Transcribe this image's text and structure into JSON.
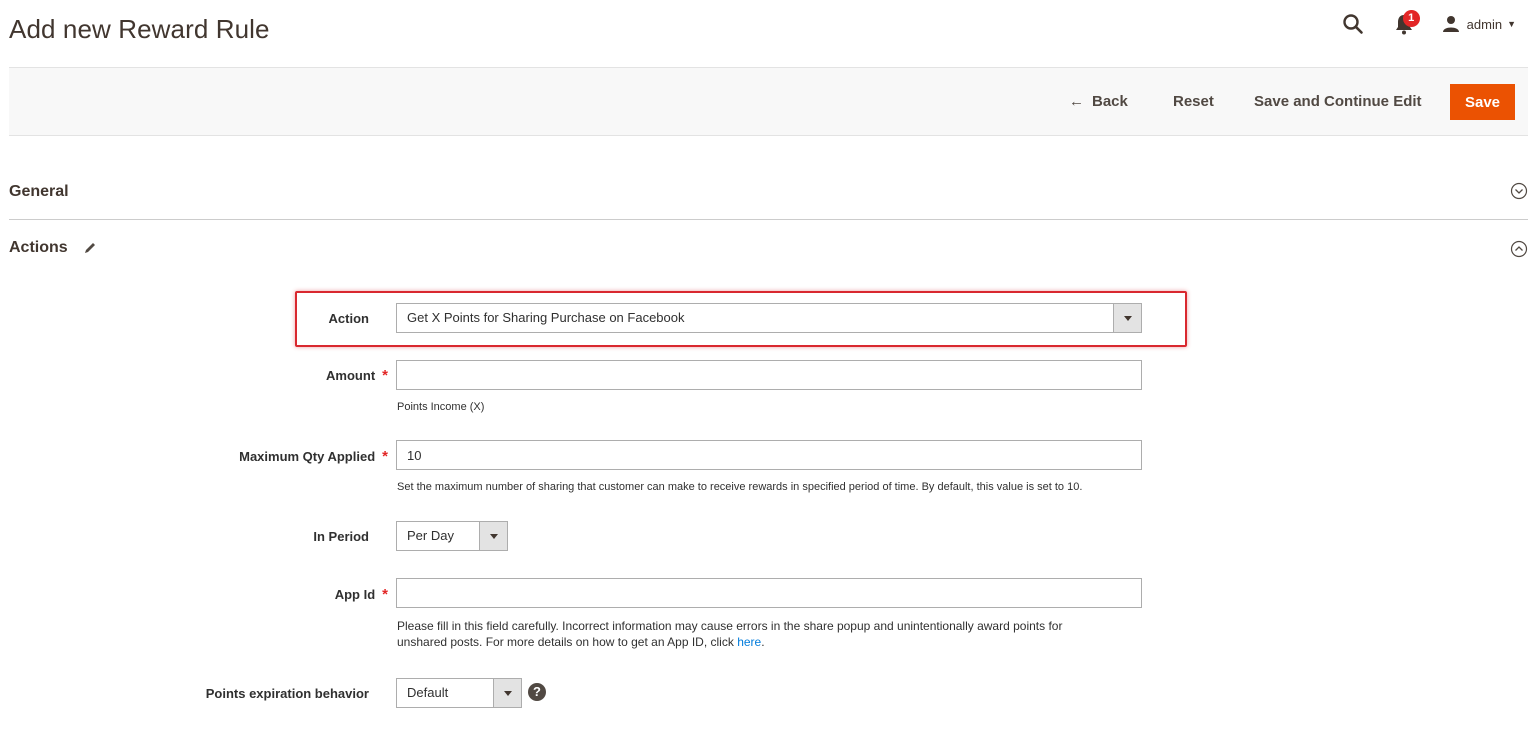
{
  "header": {
    "title": "Add new Reward Rule",
    "notifications_count": "1",
    "user_name": "admin"
  },
  "toolbar": {
    "back_label": "Back",
    "reset_label": "Reset",
    "save_continue_label": "Save and Continue Edit",
    "save_label": "Save"
  },
  "sections": {
    "general": {
      "title": "General"
    },
    "actions": {
      "title": "Actions"
    }
  },
  "form": {
    "action": {
      "label": "Action",
      "value": "Get X Points for Sharing Purchase on Facebook"
    },
    "amount": {
      "label": "Amount",
      "value": "",
      "note": "Points Income (X)"
    },
    "max_qty": {
      "label": "Maximum Qty Applied",
      "value": "10",
      "note": "Set the maximum number of sharing that customer can make to receive rewards in specified period of time. By default, this value is set to 10."
    },
    "in_period": {
      "label": "In Period",
      "value": "Per Day"
    },
    "app_id": {
      "label": "App Id",
      "value": "",
      "note_line1": "Please fill in this field carefully. Incorrect information may cause errors in the share popup and unintentionally award points for",
      "note_line2": "unshared posts. For more details on how to get an App ID, click ",
      "note_link": "here",
      "note_end": "."
    },
    "expiration": {
      "label": "Points expiration behavior",
      "value": "Default"
    }
  },
  "colors": {
    "accent": "#eb5202",
    "required": "#e22626",
    "highlight": "#d9282f",
    "link": "#007bdb"
  }
}
